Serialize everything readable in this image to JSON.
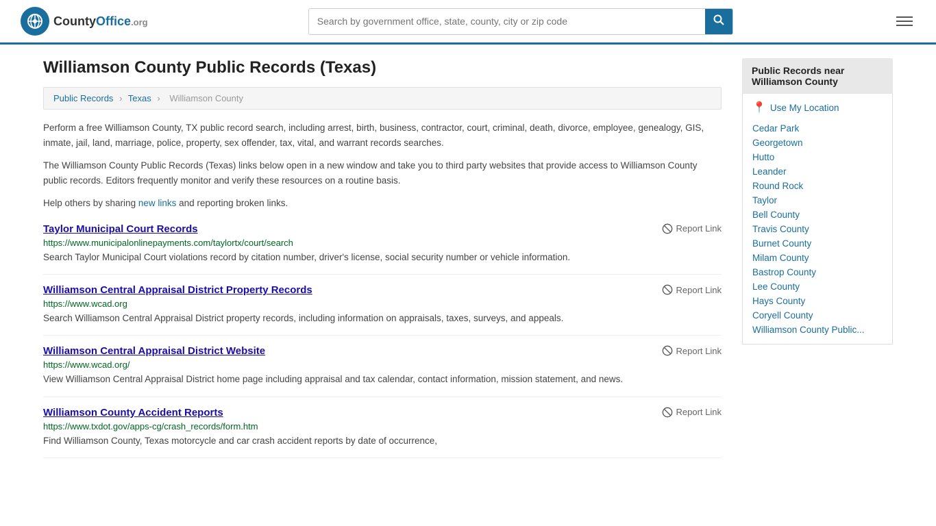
{
  "header": {
    "logo_icon": "★",
    "logo_name": "CountyOffice",
    "logo_org": ".org",
    "search_placeholder": "Search by government office, state, county, city or zip code",
    "search_btn_icon": "🔍",
    "menu_icon": "☰"
  },
  "page": {
    "title": "Williamson County Public Records (Texas)",
    "breadcrumb": {
      "items": [
        "Public Records",
        "Texas",
        "Williamson County"
      ]
    },
    "intro1": "Perform a free Williamson County, TX public record search, including arrest, birth, business, contractor, court, criminal, death, divorce, employee, genealogy, GIS, inmate, jail, land, marriage, police, property, sex offender, tax, vital, and warrant records searches.",
    "intro2": "The Williamson County Public Records (Texas) links below open in a new window and take you to third party websites that provide access to Williamson County public records. Editors frequently monitor and verify these resources on a routine basis.",
    "intro3_prefix": "Help others by sharing ",
    "intro3_link": "new links",
    "intro3_suffix": " and reporting broken links."
  },
  "records": [
    {
      "title": "Taylor Municipal Court Records",
      "url": "https://www.municipalonlinepayments.com/taylortx/court/search",
      "desc": "Search Taylor Municipal Court violations record by citation number, driver's license, social security number or vehicle information.",
      "report_label": "Report Link"
    },
    {
      "title": "Williamson Central Appraisal District Property Records",
      "url": "https://www.wcad.org",
      "desc": "Search Williamson Central Appraisal District property records, including information on appraisals, taxes, surveys, and appeals.",
      "report_label": "Report Link"
    },
    {
      "title": "Williamson Central Appraisal District Website",
      "url": "https://www.wcad.org/",
      "desc": "View Williamson Central Appraisal District home page including appraisal and tax calendar, contact information, mission statement, and news.",
      "report_label": "Report Link"
    },
    {
      "title": "Williamson County Accident Reports",
      "url": "https://www.txdot.gov/apps-cg/crash_records/form.htm",
      "desc": "Find Williamson County, Texas motorcycle and car crash accident reports by date of occurrence,",
      "report_label": "Report Link"
    }
  ],
  "sidebar": {
    "header": "Public Records near Williamson County",
    "use_location": "Use My Location",
    "links": [
      "Cedar Park",
      "Georgetown",
      "Hutto",
      "Leander",
      "Round Rock",
      "Taylor",
      "Bell County",
      "Travis County",
      "Burnet County",
      "Milam County",
      "Bastrop County",
      "Lee County",
      "Hays County",
      "Coryell County",
      "Williamson County Public..."
    ]
  }
}
